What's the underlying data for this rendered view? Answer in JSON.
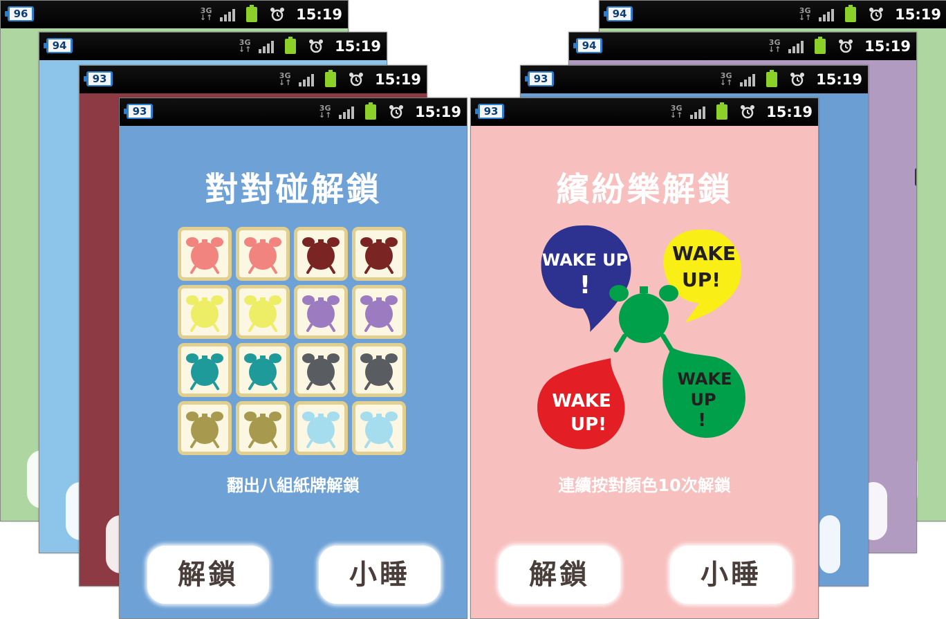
{
  "status_bar": {
    "clock": "15:19",
    "network": "3G"
  },
  "background_phones": [
    {
      "battery": "96",
      "color": "#aed6a1"
    },
    {
      "battery": "94",
      "color": "#8cc4ea"
    },
    {
      "battery": "93",
      "color": "#8e3a45"
    },
    {
      "battery": "94",
      "color": "#a9cdea"
    },
    {
      "battery": "94",
      "color": "#b19bc1"
    },
    {
      "battery": "93",
      "color": "#6b9fd4"
    }
  ],
  "front_left": {
    "battery": "93",
    "title": "對對碰解鎖",
    "hint": "翻出八組紙牌解鎖",
    "unlock_label": "解鎖",
    "snooze_label": "小睡",
    "background": "#6ea1d6",
    "card_colors": [
      "#f28480",
      "#f28480",
      "#7a2423",
      "#7a2423",
      "#eded66",
      "#eded66",
      "#9d7bc0",
      "#9d7bc0",
      "#1f9a9b",
      "#1f9a9b",
      "#595d61",
      "#595d61",
      "#a79a4e",
      "#a79a4e",
      "#a5dcee",
      "#a5dcee"
    ]
  },
  "front_right": {
    "battery": "93",
    "title": "繽紛樂解鎖",
    "hint": "連續按對顏色10次解鎖",
    "unlock_label": "解鎖",
    "snooze_label": "小睡",
    "background": "#f7bfbe",
    "bubbles": [
      {
        "color": "#2d3190",
        "text": "WAKE UP !"
      },
      {
        "color": "#f9ee16",
        "text": "WAKE UP !"
      },
      {
        "color": "#e31e24",
        "text": "WAKE UP !"
      },
      {
        "color": "#00a04a",
        "text": "WAKE UP !"
      }
    ]
  }
}
